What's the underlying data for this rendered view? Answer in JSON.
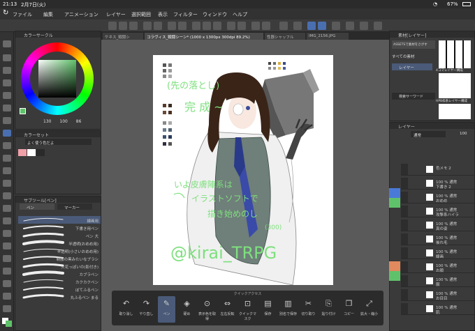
{
  "status_bar": {
    "time": "21:13",
    "date": "2月7日(火)",
    "battery": "67%"
  },
  "menu": [
    "ファイル",
    "編集",
    "アニメーション",
    "レイヤー",
    "選択範囲",
    "表示",
    "フィルター",
    "ウィンドウ",
    "ヘルプ"
  ],
  "color_panel": {
    "title": "カラーサークル",
    "readout": [
      "130",
      "100",
      "86"
    ]
  },
  "color_set": {
    "title": "カラーセット",
    "preset": "よく使う色だよ"
  },
  "brush_panel": {
    "tabs": [
      "サブツール[ペン]",
      "ペン",
      "マーカー"
    ],
    "items": [
      "線画用",
      "下書き用ペン",
      "ペン 大",
      "半透明(おめめ用)",
      "半透明(小さいおめめ用)",
      "制服の黒みたいなブラシ",
      "火花っぽいの(影付き)",
      "カブラペン",
      "カクカクペン",
      "ぼてふるペン",
      "丸ふるペン まる"
    ]
  },
  "canvas_tabs": [
    "ケネス_戦闘シ",
    "コラヴィス_戦闘シーン* (1000 x 1300px 300dpi 89.2%)",
    "性器シャッフル",
    "IMG_2156.JPG"
  ],
  "artwork": {
    "texts": [
      "(先の落とし)",
      "完 成 ~",
      "いよ皮膚陣系は",
      "イラストソフトで",
      "描き始めのし",
      "(300)",
      "@kirai_TRPG"
    ]
  },
  "quick_access": {
    "title": "クイックアクセス",
    "buttons": [
      "取り消し",
      "やり直し",
      "ペン",
      "硬め",
      "表示色を取得",
      "左右反転",
      "クイックマスク",
      "保存",
      "別名で保存",
      "切り取り",
      "貼り付け",
      "コピー",
      "拡大・縮小"
    ]
  },
  "material_panel": {
    "title": "素材[レイヤー]",
    "items": [
      "ASSETSで素材をさがす",
      "すべての素材",
      "レイヤー",
      "検索サーワード"
    ],
    "thumbs": [
      "4コマレイヤー構成",
      "HPB枠系レイヤー構成"
    ]
  },
  "layer_panel": {
    "title": "レイヤー",
    "blend": "通常",
    "opacity": "100",
    "rows": [
      {
        "name": "色メモ 2"
      },
      {
        "name": "100 % 通常",
        "sub": "下書き 2"
      },
      {
        "name": "100 % 通常",
        "sub": "おめめ"
      },
      {
        "name": "100 % 通常",
        "sub": "攻撃系ハイラ"
      },
      {
        "name": "100 % 通常",
        "sub": "真の姿"
      },
      {
        "name": "100 % 通常",
        "sub": "後れ毛"
      },
      {
        "name": "100 % 通常",
        "sub": "線画"
      },
      {
        "name": "100 % 通常",
        "sub": "お顔"
      },
      {
        "name": "100 % 通常",
        "sub": "服"
      },
      {
        "name": "100 % 通常",
        "sub": "お目目"
      },
      {
        "name": "100 % 通常",
        "sub": "肌"
      }
    ]
  },
  "colors": {
    "accent": "#4a6fb0",
    "panel": "#3a3a3a",
    "selected": "#4a5a78",
    "green": "#5fc26a",
    "blue": "#4a7ad8",
    "orange": "#e08a5e"
  }
}
